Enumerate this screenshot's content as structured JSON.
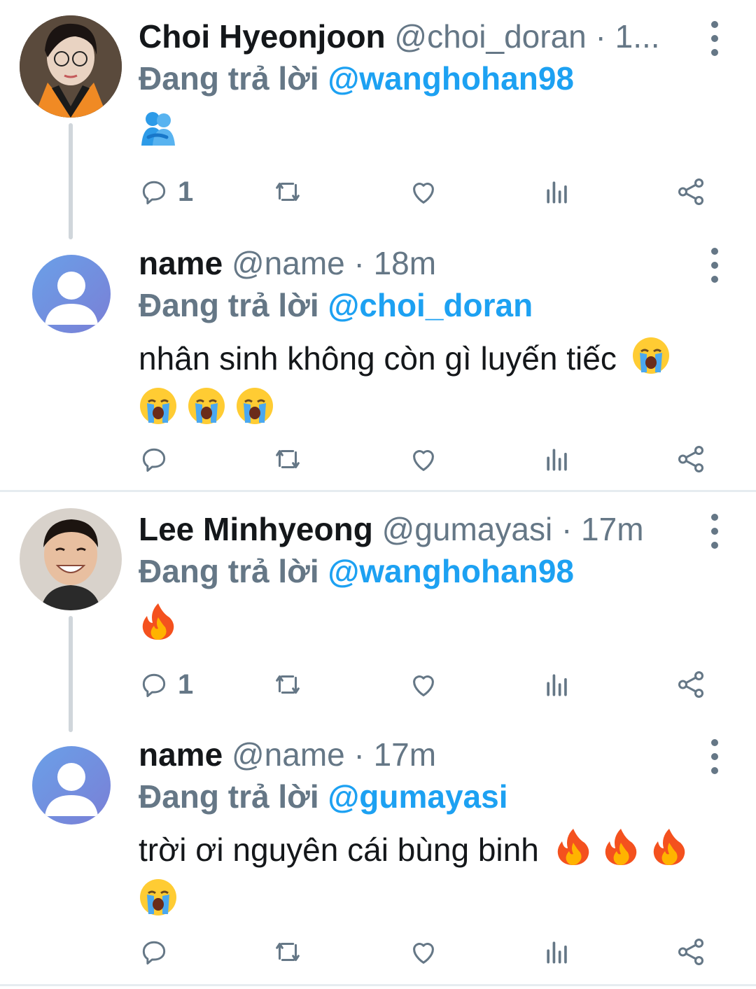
{
  "tweets": [
    {
      "name": "Choi Hyeonjoon",
      "handle": "@choi_doran · 1...",
      "reply_prefix": "Đang trả lời",
      "reply_to": "@wanghohan98",
      "text": "",
      "emojis": [
        "people-hugging"
      ],
      "reply_count": "1"
    },
    {
      "name": "name",
      "handle": "@name · 18m",
      "reply_prefix": "Đang trả lời",
      "reply_to": "@choi_doran",
      "text": "nhân sinh không còn gì luyến tiếc",
      "emojis": [
        "loudly-crying-face",
        "loudly-crying-face",
        "loudly-crying-face",
        "loudly-crying-face"
      ],
      "reply_count": ""
    },
    {
      "name": "Lee Minhyeong",
      "handle": "@gumayasi · 17m",
      "reply_prefix": "Đang trả lời",
      "reply_to": "@wanghohan98",
      "text": "",
      "emojis": [
        "fire"
      ],
      "reply_count": "1"
    },
    {
      "name": "name",
      "handle": "@name · 17m",
      "reply_prefix": "Đang trả lời",
      "reply_to": "@gumayasi",
      "text": "trời ơi nguyên cái bùng binh",
      "emojis": [
        "fire",
        "fire",
        "fire",
        "loudly-crying-face"
      ],
      "reply_count": ""
    }
  ],
  "colors": {
    "accent": "#1da1f2",
    "secondary_text": "#657786",
    "primary_text": "#14171a",
    "divider": "#e6ecf0",
    "thread_line": "#d0d6db"
  },
  "icons": [
    "reply-icon",
    "retweet-icon",
    "like-icon",
    "analytics-icon",
    "share-icon",
    "more-icon"
  ]
}
